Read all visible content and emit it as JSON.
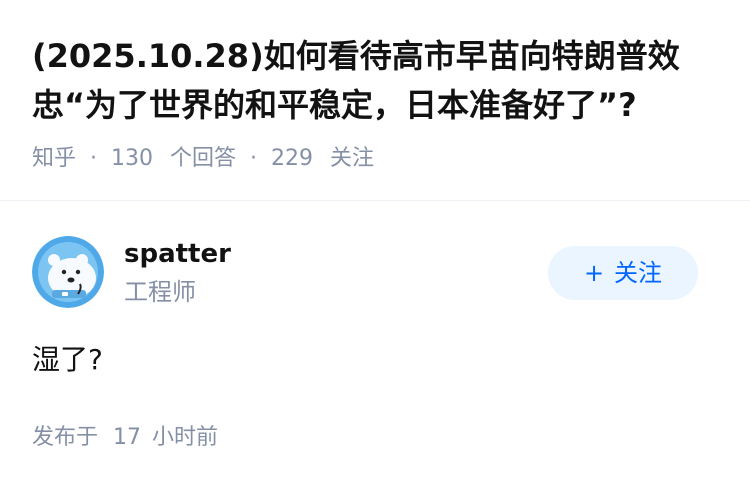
{
  "question": {
    "title": "(2025.10.28)如何看待高市早苗向特朗普效忠“为了世界的和平稳定，日本准备好了”?",
    "source": "知乎",
    "separator": "·",
    "answers_count": "130",
    "answers_label": "个回答",
    "followers_count": "229",
    "followers_label": "关注"
  },
  "author": {
    "name": "spatter",
    "headline": "工程师",
    "avatar_icon": "polar-bear-avatar-icon",
    "follow_plus": "+",
    "follow_label": "关注"
  },
  "answer": {
    "content": "湿了?",
    "published_prefix": "发布于",
    "published_count": "17",
    "published_unit": "小时前"
  },
  "colors": {
    "text_primary": "#121212",
    "text_secondary": "#8590a6",
    "brand_blue": "#0066ff",
    "follow_bg": "#ebf5ff",
    "divider": "#f0f2f7"
  }
}
